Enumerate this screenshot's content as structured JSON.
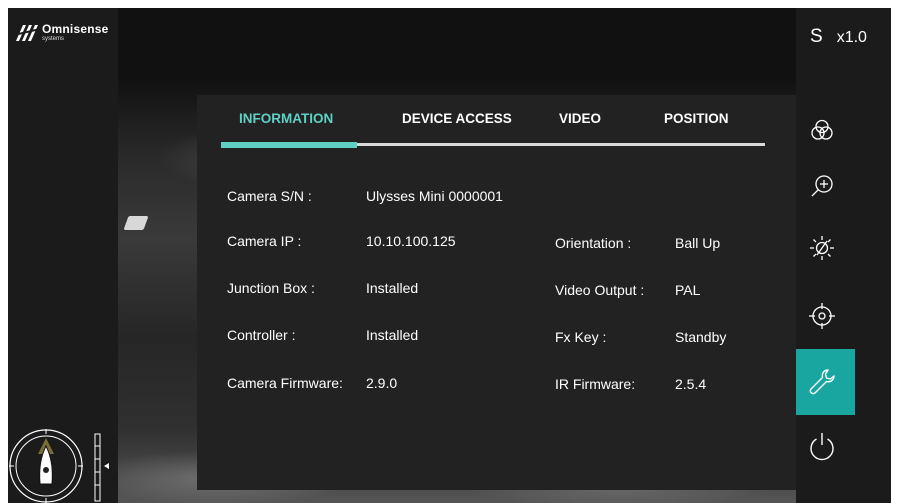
{
  "brand": {
    "name": "Omnisense",
    "sub": "systems"
  },
  "status": {
    "mode": "S",
    "zoom": "x1.0"
  },
  "tabs": [
    {
      "label": "INFORMATION",
      "active": true
    },
    {
      "label": "DEVICE ACCESS",
      "active": false
    },
    {
      "label": "VIDEO",
      "active": false
    },
    {
      "label": "POSITION",
      "active": false
    }
  ],
  "info": {
    "camera_sn": {
      "label": "Camera S/N :",
      "value": "Ulysses Mini 0000001"
    },
    "camera_ip": {
      "label": "Camera IP :",
      "value": "10.10.100.125"
    },
    "junction_box": {
      "label": "Junction Box :",
      "value": "Installed"
    },
    "controller": {
      "label": "Controller :",
      "value": "Installed"
    },
    "camera_firmware": {
      "label": "Camera  Firmware:",
      "value": "2.9.0"
    },
    "orientation": {
      "label": "Orientation :",
      "value": "Ball Up"
    },
    "video_output": {
      "label": "Video Output :",
      "value": "PAL"
    },
    "fx_key": {
      "label": "Fx Key :",
      "value": "Standby"
    },
    "ir_firmware": {
      "label": "IR Firmware:",
      "value": "2.5.4"
    }
  },
  "toolbar": [
    {
      "icon": "color-filter-icon",
      "active": false
    },
    {
      "icon": "zoom-in-icon",
      "active": false
    },
    {
      "icon": "focus-icon",
      "active": false
    },
    {
      "icon": "target-icon",
      "active": false
    },
    {
      "icon": "wrench-icon",
      "active": true
    },
    {
      "icon": "power-icon",
      "active": false
    }
  ],
  "colors": {
    "accent": "#5fd0c4",
    "active_button": "#1aa6a0",
    "panel": "#222222",
    "background": "#1b1b1b"
  }
}
